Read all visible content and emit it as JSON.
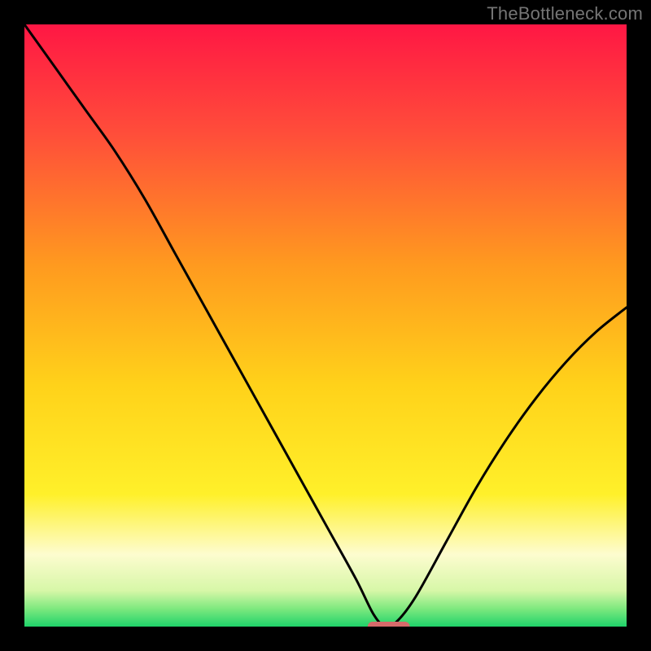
{
  "watermark": "TheBottleneck.com",
  "colors": {
    "gradient": [
      {
        "offset": "0%",
        "hex": "#ff1744"
      },
      {
        "offset": "18%",
        "hex": "#ff4d3a"
      },
      {
        "offset": "40%",
        "hex": "#ff9a1f"
      },
      {
        "offset": "60%",
        "hex": "#ffd21a"
      },
      {
        "offset": "78%",
        "hex": "#fff02a"
      },
      {
        "offset": "88%",
        "hex": "#fdfccf"
      },
      {
        "offset": "94%",
        "hex": "#d7f7a8"
      },
      {
        "offset": "97%",
        "hex": "#7fe97f"
      },
      {
        "offset": "100%",
        "hex": "#1fd36a"
      }
    ],
    "curve": "#000000",
    "marker": "#d66a6a",
    "frame": "#000000"
  },
  "chart_data": {
    "type": "line",
    "title": "",
    "xlabel": "",
    "ylabel": "",
    "xlim": [
      0,
      100
    ],
    "ylim": [
      0,
      100
    ],
    "optimal_x": 60,
    "series": [
      {
        "name": "bottleneck",
        "x": [
          0,
          5,
          10,
          15,
          20,
          25,
          30,
          35,
          40,
          45,
          50,
          55,
          58,
          60,
          62,
          65,
          70,
          75,
          80,
          85,
          90,
          95,
          100
        ],
        "y": [
          100,
          93,
          86,
          79,
          71,
          62,
          53,
          44,
          35,
          26,
          17,
          8,
          2,
          0,
          1,
          5,
          14,
          23,
          31,
          38,
          44,
          49,
          53
        ]
      }
    ],
    "marker": {
      "x_start": 57,
      "x_end": 64,
      "y": 0
    }
  }
}
